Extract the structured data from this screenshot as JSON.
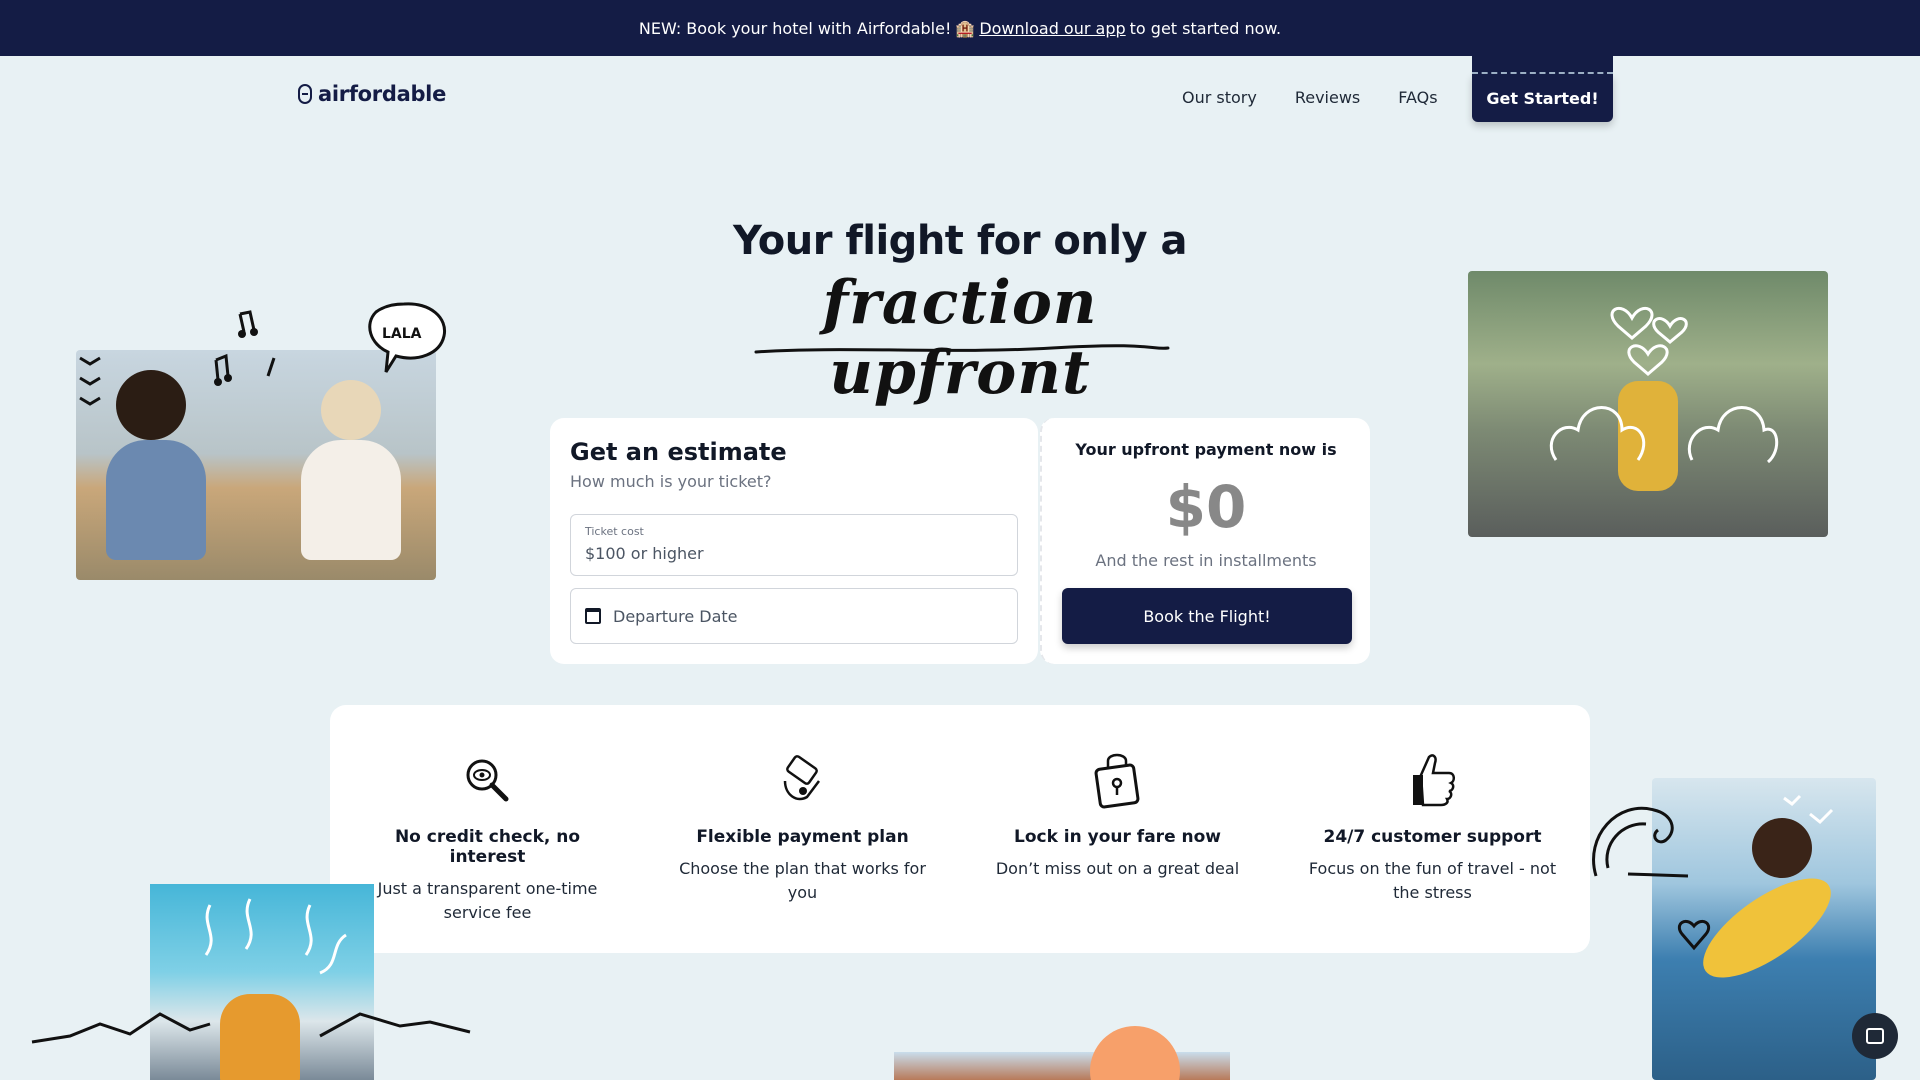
{
  "announcement": {
    "prefix": "NEW: Book your hotel with Airfordable!",
    "hotel_icon": "🏨",
    "link": "Download our app",
    "suffix": "to get started now."
  },
  "header": {
    "logo": "airfordable",
    "nav": [
      "Our story",
      "Reviews",
      "FAQs"
    ],
    "cta": "Get Started!"
  },
  "hero": {
    "title": "Your flight for only a",
    "script": "fraction upfront"
  },
  "estimate": {
    "title": "Get an estimate",
    "subtitle": "How much is your ticket?",
    "ticket_label": "Ticket cost",
    "ticket_placeholder": "$100 or higher",
    "date_placeholder": "Departure Date"
  },
  "payment": {
    "title": "Your upfront payment now is",
    "amount": "$0",
    "rest": "And the rest in installments",
    "button": "Book the Flight!"
  },
  "features": [
    {
      "icon": "magnifier-eye-icon",
      "title": "No credit check, no interest",
      "desc": "Just a transparent one-time service fee"
    },
    {
      "icon": "hand-card-icon",
      "title": "Flexible payment plan",
      "desc": "Choose the plan that works for you"
    },
    {
      "icon": "lock-bag-icon",
      "title": "Lock in your fare now",
      "desc": "Don’t miss out on a great deal"
    },
    {
      "icon": "thumbs-up-icon",
      "title": "24/7 customer support",
      "desc": "Focus on the fun of travel - not the stress"
    }
  ],
  "doodles": {
    "speech_bubble": "LALA"
  },
  "colors": {
    "navy": "#141c45",
    "background": "#e8f1f4"
  }
}
